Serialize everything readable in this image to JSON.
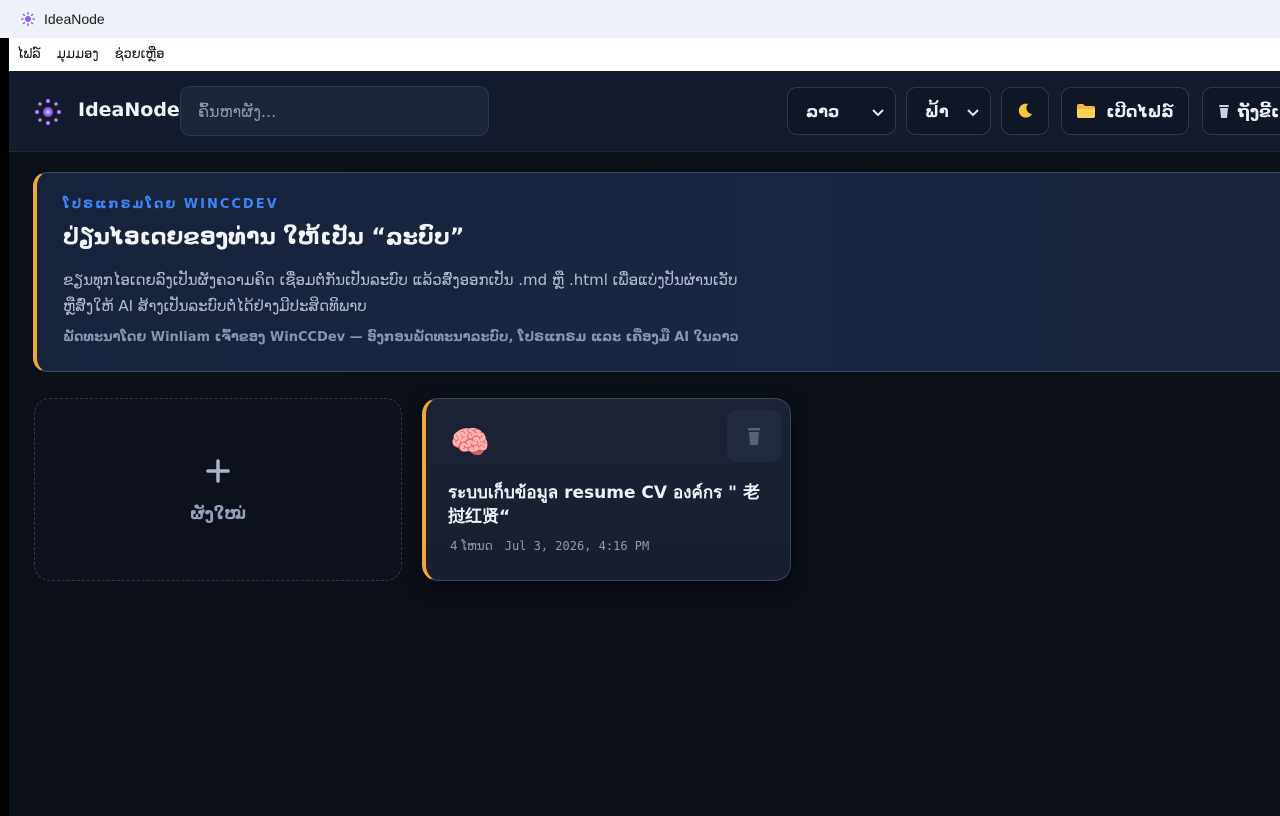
{
  "window": {
    "title": "IdeaNode"
  },
  "menu": [
    "ໄຟລ໌",
    "ມຸມມອງ",
    "ຊ່ວຍເຫຼືອ"
  ],
  "header": {
    "logo_text": "IdeaNode",
    "search_placeholder": "ຄົ້ນຫາຜັງ...",
    "language_value": "ລາວ",
    "theme_value": "ຟ້າ",
    "dark_toggle_icon": "moon-icon",
    "open_file_label": "ເປີດໄຟລ໌",
    "bin_label": "ຖັງຂີ້ເ"
  },
  "banner": {
    "kicker": "ໂປຣແກຣມໂດຍ WINCCDEV",
    "headline": "ປ່ຽນໄອເດຍຂອງທ່ານ ໃຫ້ເປັນ “ລະບົບ”",
    "description_line1": "ຂຽນທຸກໄອເດຍລົງເປັນຜັງຄວາມຄິດ ເຊື່ອມຕໍ່ກັນເປັນລະບົບ ແລ້ວສົ່ງອອກເປັນ .md ຫຼື .html ເພື່ອແບ່ງປັນຜ່ານເວັບ",
    "description_line2": "ຫຼືສົ່ງໃຫ້ AI ສ້າງເປັນລະບົບຕໍ່ໄດ້ຢ່າງມີປະສິດທິພາບ",
    "credit": "ພັດທະນາໂດຍ Winliam ເຈົ້າຂອງ WinCCDev — ອົງກອນພັດທະນາລະບົບ, ໂປຣແກຣມ ແລະ ເຄື່ອງມື AI ໃນລາວ"
  },
  "new_card": {
    "label": "ຜັງໃໝ່"
  },
  "cards": [
    {
      "emoji": "🧠",
      "title": "ระบบเก็บข้อมูล resume CV องค์กร \" 老挝红贤“",
      "node_count": "4 ໂຫນດ",
      "date": "Jul 3, 2026, 4:16 PM"
    }
  ],
  "colors": {
    "accent": "#f0a73a",
    "kicker": "#3b86f7",
    "background": "#0b0f17",
    "header": "#131b2c"
  }
}
